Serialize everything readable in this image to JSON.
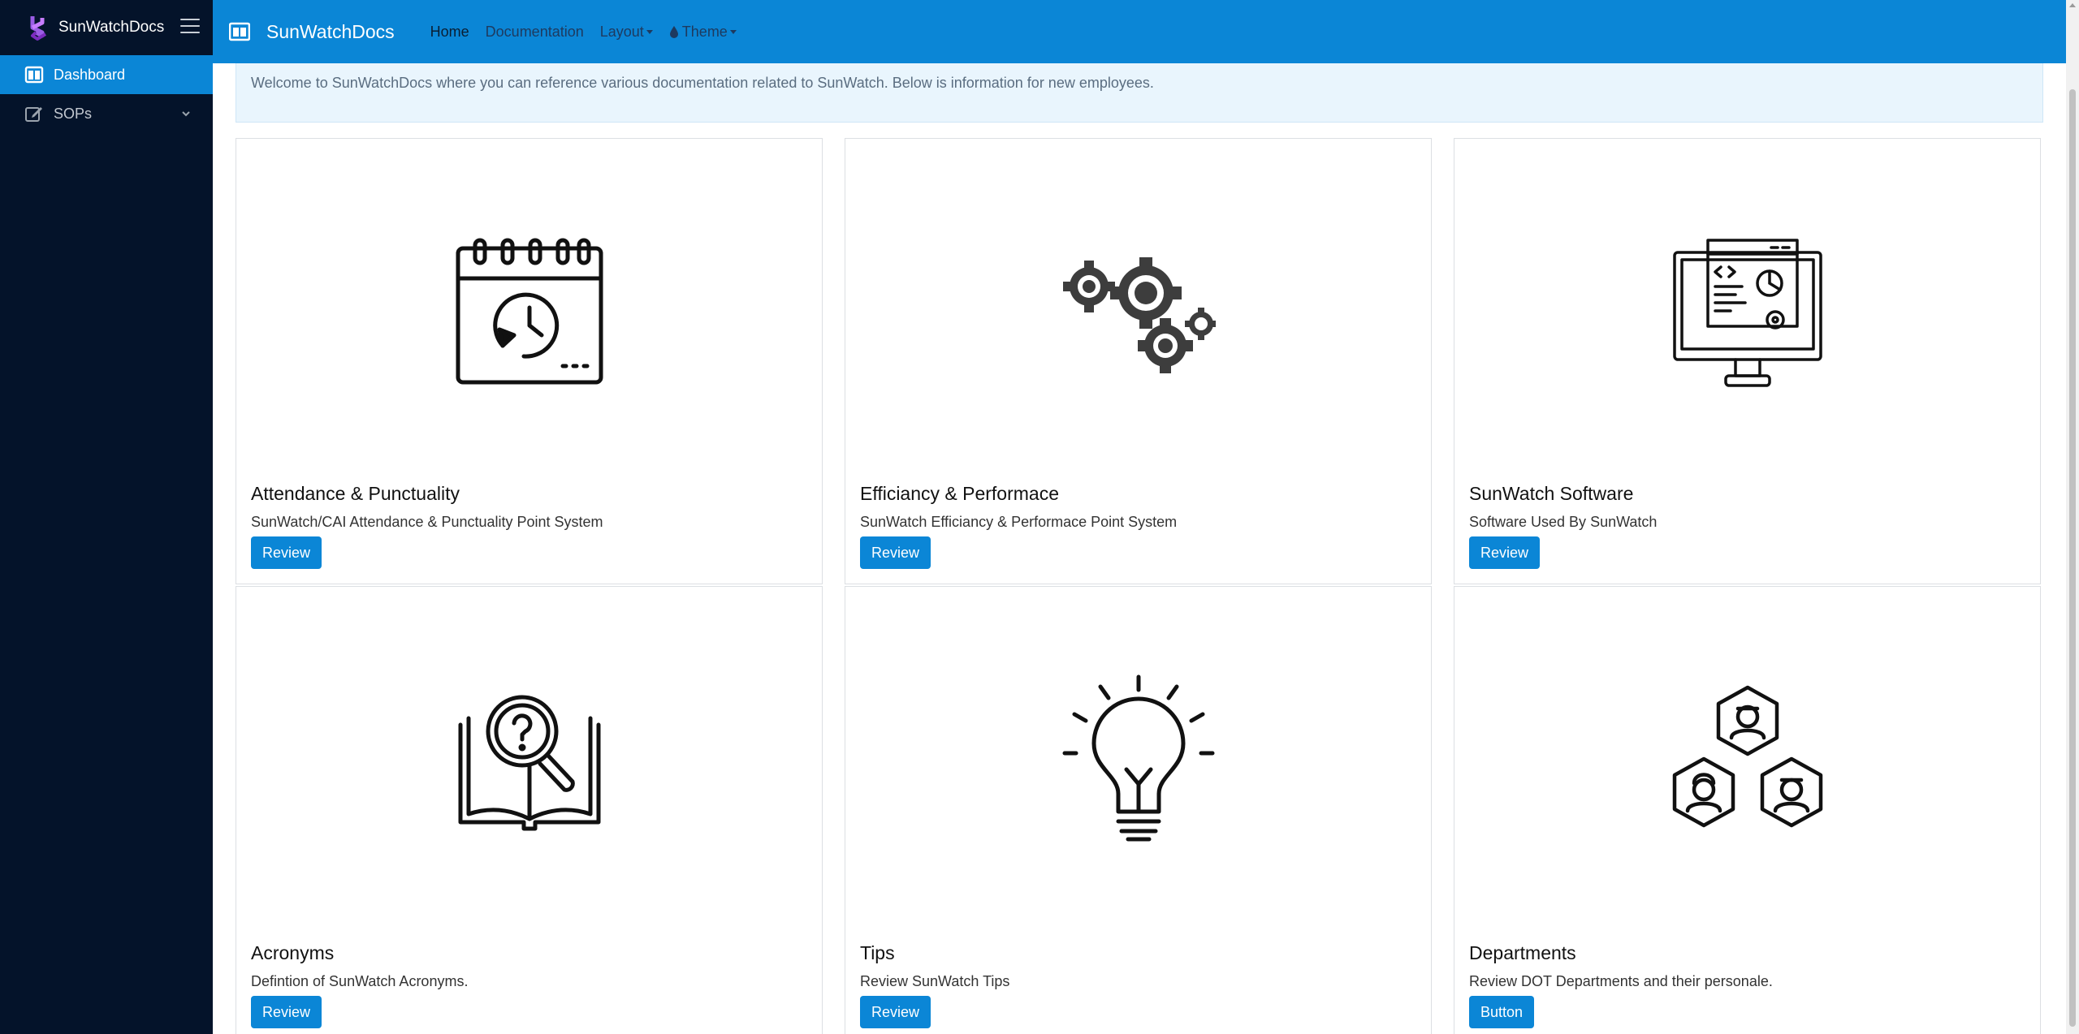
{
  "app": {
    "name": "SunWatchDocs"
  },
  "sidebar": {
    "items": [
      {
        "label": "Dashboard",
        "icon": "columns-icon"
      },
      {
        "label": "SOPs",
        "icon": "edit-icon"
      }
    ]
  },
  "topbar": {
    "brand": "SunWatchDocs",
    "links": [
      {
        "label": "Home"
      },
      {
        "label": "Documentation"
      },
      {
        "label": "Layout"
      },
      {
        "label": "Theme"
      }
    ]
  },
  "alert": {
    "text": "Welcome to SunWatchDocs where you can reference various documentation related to SunWatch. Below is information for new employees."
  },
  "cards": [
    {
      "title": "Attendance & Punctuality",
      "description": "SunWatch/CAI Attendance & Punctuality Point System",
      "button": "Review",
      "icon": "calendar-clock-icon"
    },
    {
      "title": "Efficiancy & Performace",
      "description": "SunWatch Efficiancy & Performace Point System",
      "button": "Review",
      "icon": "gears-icon"
    },
    {
      "title": "SunWatch Software",
      "description": "Software Used By SunWatch",
      "button": "Review",
      "icon": "computer-monitor-icon"
    },
    {
      "title": "Acronyms",
      "description": "Defintion of SunWatch Acronyms.",
      "button": "Review",
      "icon": "book-magnifier-icon"
    },
    {
      "title": "Tips",
      "description": "Review SunWatch Tips",
      "button": "Review",
      "icon": "lightbulb-icon"
    },
    {
      "title": "Departments",
      "description": "Review DOT Departments and their personale.",
      "button": "Button",
      "icon": "team-hexagon-icon"
    }
  ],
  "colors": {
    "accent": "#0b86d6",
    "sidebar_bg": "#04132a",
    "alert_bg": "#e9f5fd"
  }
}
